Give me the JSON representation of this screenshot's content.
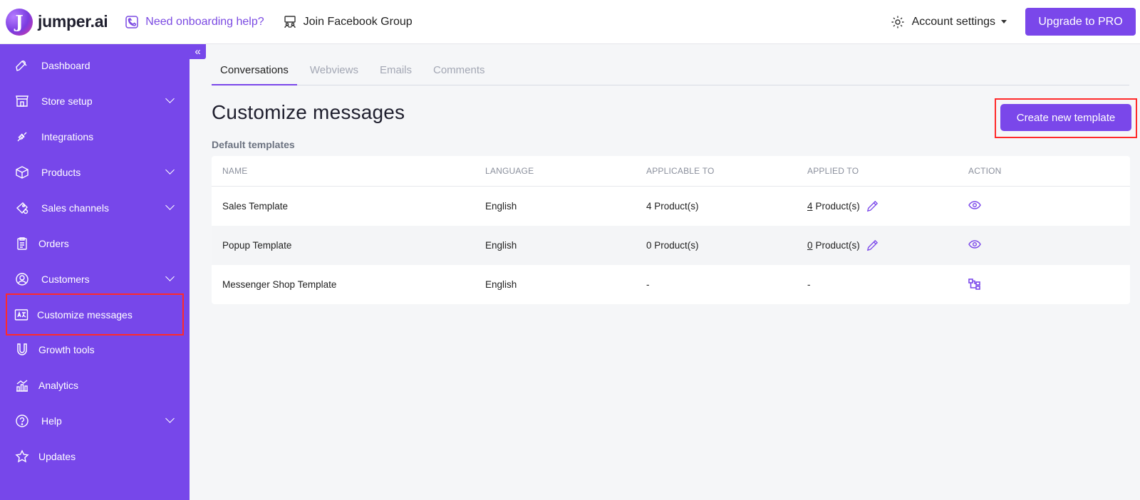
{
  "brand": {
    "name": "jumper.ai",
    "mark": "J"
  },
  "topbar": {
    "help_link": "Need onboarding help?",
    "fb_link": "Join Facebook Group",
    "account_label": "Account settings",
    "upgrade_label": "Upgrade to PRO"
  },
  "sidebar": {
    "collapse_glyph": "«",
    "items": [
      {
        "label": "Dashboard",
        "icon": "rocket-icon",
        "chevron": false
      },
      {
        "label": "Store setup",
        "icon": "store-icon",
        "chevron": true
      },
      {
        "label": "Integrations",
        "icon": "plug-icon",
        "chevron": false
      },
      {
        "label": "Products",
        "icon": "box-icon",
        "chevron": true
      },
      {
        "label": "Sales channels",
        "icon": "channels-icon",
        "chevron": true
      },
      {
        "label": "Orders",
        "icon": "clipboard-icon",
        "chevron": false
      },
      {
        "label": "Customers",
        "icon": "user-icon",
        "chevron": true
      },
      {
        "label": "Customize messages",
        "icon": "translate-icon",
        "chevron": false,
        "active": true
      },
      {
        "label": "Growth tools",
        "icon": "magnet-icon",
        "chevron": false
      },
      {
        "label": "Analytics",
        "icon": "analytics-icon",
        "chevron": false
      },
      {
        "label": "Help",
        "icon": "help-icon",
        "chevron": true
      },
      {
        "label": "Updates",
        "icon": "star-icon",
        "chevron": false
      }
    ]
  },
  "tabs": [
    "Conversations",
    "Webviews",
    "Emails",
    "Comments"
  ],
  "main": {
    "title": "Customize messages",
    "create_button": "Create new template",
    "section_label": "Default templates"
  },
  "table": {
    "headers": [
      "NAME",
      "LANGUAGE",
      "APPLICABLE TO",
      "APPLIED TO",
      "ACTION"
    ],
    "rows": [
      {
        "name": "Sales Template",
        "language": "English",
        "applicable": "4 Product(s)",
        "applied_count": "4",
        "applied_suffix": "Product(s)",
        "action": "eye-icon"
      },
      {
        "name": "Popup Template",
        "language": "English",
        "applicable": "0 Product(s)",
        "applied_count": "0",
        "applied_suffix": "Product(s)",
        "action": "eye-icon"
      },
      {
        "name": "Messenger Shop Template",
        "language": "English",
        "applicable": "-",
        "applied_text": "-",
        "action": "flow-icon"
      }
    ]
  },
  "colors": {
    "accent": "#7a47ea",
    "sidebar": "#7747ea",
    "highlight": "#ff2a2a"
  }
}
